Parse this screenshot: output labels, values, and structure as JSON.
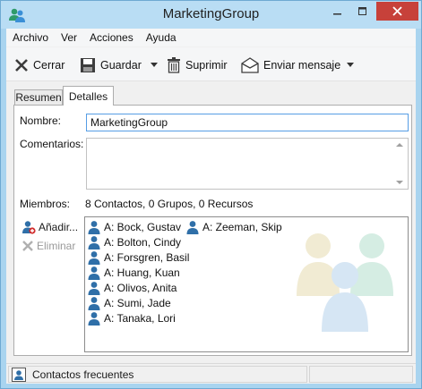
{
  "window": {
    "title": "MarketingGroup"
  },
  "menu": [
    "Archivo",
    "Ver",
    "Acciones",
    "Ayuda"
  ],
  "toolbar": {
    "close_label": "Cerrar",
    "save_label": "Guardar",
    "delete_label": "Suprimir",
    "send_label": "Enviar mensaje"
  },
  "tabs": [
    {
      "label": "Resumen",
      "selected": false
    },
    {
      "label": "Detalles",
      "selected": true
    }
  ],
  "form": {
    "name_label": "Nombre:",
    "name_value": "MarketingGroup",
    "comments_label": "Comentarios:",
    "comments_value": "",
    "members_label": "Miembros:",
    "members_summary": "8 Contactos, 0 Grupos, 0 Recursos",
    "add_label": "Añadir...",
    "remove_label": "Eliminar"
  },
  "members": [
    "A: Bock, Gustav",
    "A: Bolton, Cindy",
    "A: Forsgren, Basil",
    "A: Huang, Kuan",
    "A: Olivos, Anita",
    "A: Sumi, Jade",
    "A: Tanaka, Lori",
    "A: Zeeman, Skip"
  ],
  "status": {
    "text": "Contactos frecuentes"
  },
  "colors": {
    "close_button": "#c7413a",
    "accent": "#569de5",
    "person_icon": "#2f6fa8"
  }
}
